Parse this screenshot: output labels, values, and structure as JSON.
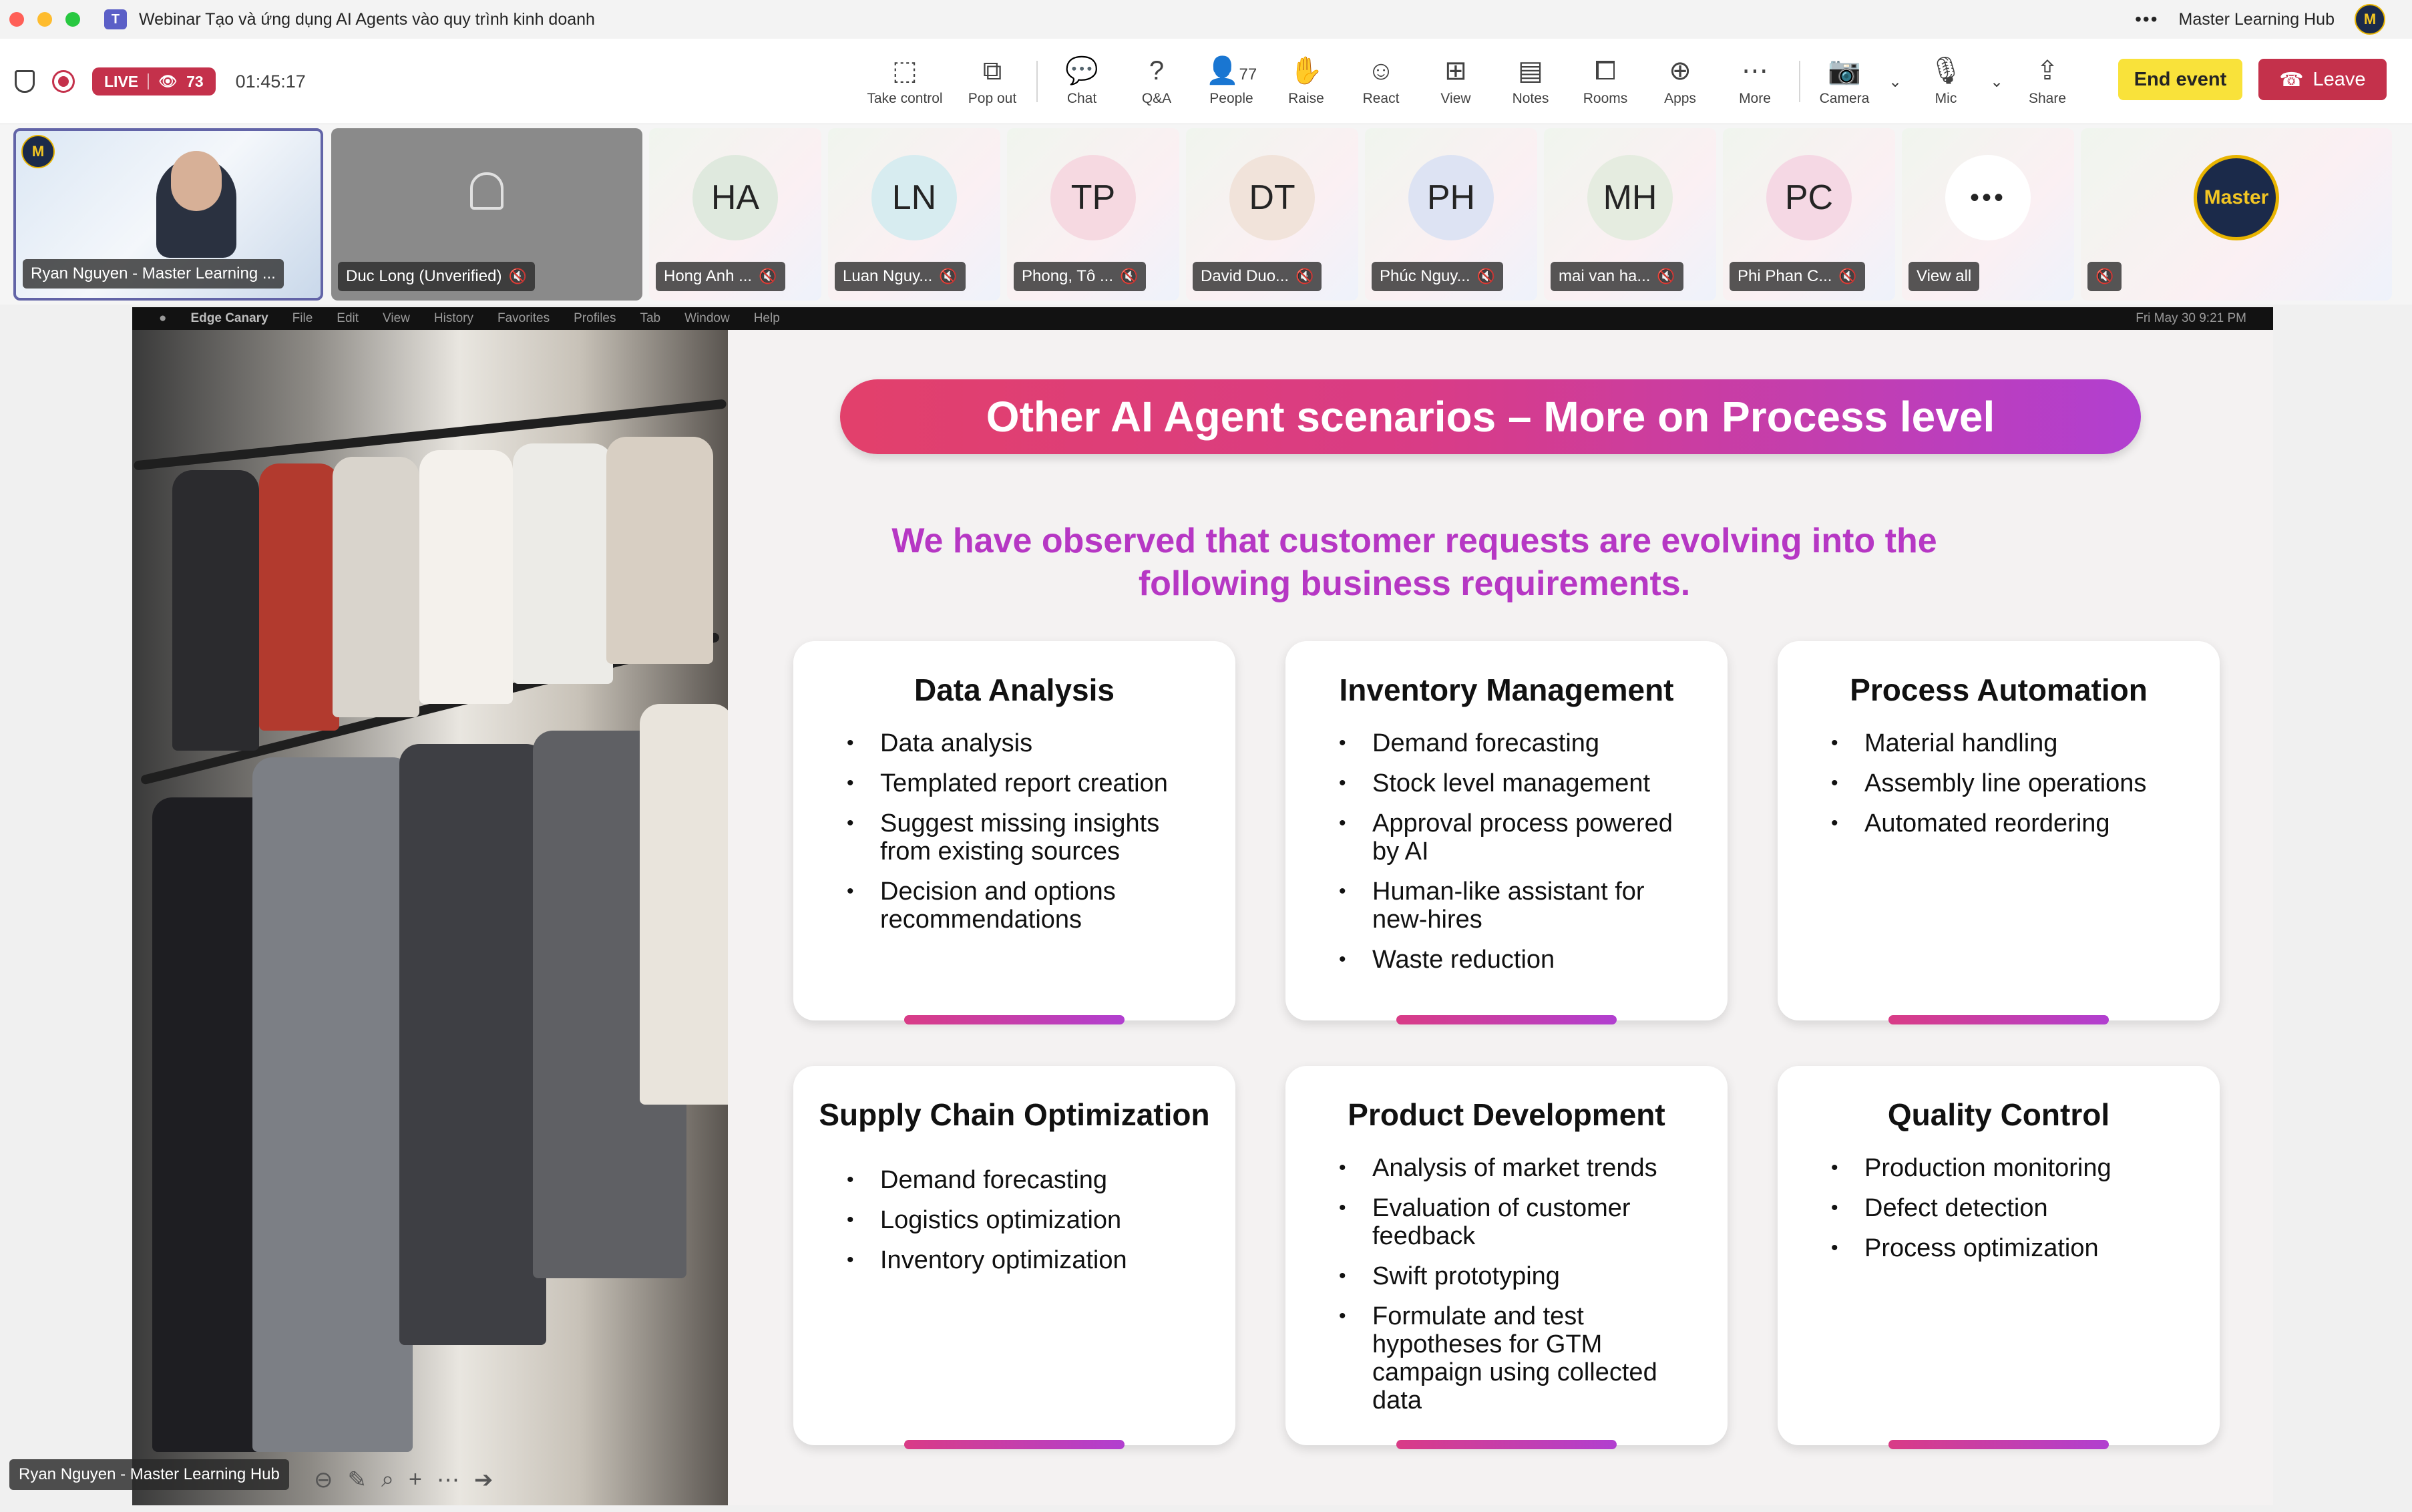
{
  "window": {
    "title": "Webinar Tạo và ứng dụng AI Agents vào quy trình kinh doanh",
    "org": "Master Learning Hub"
  },
  "status": {
    "live": "LIVE",
    "viewers": "73",
    "elapsed": "01:45:17"
  },
  "toolbar": {
    "take_control": "Take control",
    "pop_out": "Pop out",
    "chat": "Chat",
    "qa": "Q&A",
    "people": "People",
    "people_count": "77",
    "raise": "Raise",
    "react": "React",
    "view": "View",
    "notes": "Notes",
    "rooms": "Rooms",
    "apps": "Apps",
    "more": "More",
    "camera": "Camera",
    "mic": "Mic",
    "share": "Share",
    "end_event": "End event",
    "leave": "Leave"
  },
  "participants": [
    {
      "name": "Ryan Nguyen - Master Learning ..."
    },
    {
      "name": "Duc Long (Unverified)"
    },
    {
      "initials": "HA",
      "name": "Hong Anh ...",
      "color": "#dfe9de"
    },
    {
      "initials": "LN",
      "name": "Luan Nguy...",
      "color": "#d7ecf0"
    },
    {
      "initials": "TP",
      "name": "Phong, Tô ...",
      "color": "#f6d9e1"
    },
    {
      "initials": "DT",
      "name": "David Duo...",
      "color": "#f1e3da"
    },
    {
      "initials": "PH",
      "name": "Phúc Nguy...",
      "color": "#dde3f3"
    },
    {
      "initials": "MH",
      "name": "mai van ha...",
      "color": "#e5ece0"
    },
    {
      "initials": "PC",
      "name": "Phi Phan C...",
      "color": "#f5d8e4"
    },
    {
      "name": "View all"
    },
    {
      "logo": "Master"
    }
  ],
  "shared_screen": {
    "menubar": [
      "Edge Canary",
      "File",
      "Edit",
      "View",
      "History",
      "Favorites",
      "Profiles",
      "Tab",
      "Window",
      "Help"
    ],
    "clock": "Fri May 30  9:21 PM"
  },
  "slide": {
    "title": "Other AI Agent scenarios – More on Process level",
    "subtitle": "We have observed that customer requests are evolving into the following business requirements.",
    "cards": [
      {
        "title": "Data Analysis",
        "items": [
          "Data analysis",
          "Templated report creation",
          "Suggest missing insights from existing sources",
          "Decision and options recommendations"
        ]
      },
      {
        "title": "Inventory Management",
        "items": [
          "Demand forecasting",
          "Stock level management",
          "Approval process powered by AI",
          "Human-like assistant for new-hires",
          "Waste reduction"
        ]
      },
      {
        "title": "Process Automation",
        "items": [
          "Material handling",
          "Assembly line operations",
          "Automated reordering"
        ]
      },
      {
        "title": "Supply Chain Optimization",
        "items": [
          "Demand forecasting",
          "Logistics optimization",
          "Inventory optimization"
        ]
      },
      {
        "title": "Product Development",
        "items": [
          "Analysis of market trends",
          "Evaluation of customer feedback",
          "Swift prototyping",
          "Formulate and test hypotheses for GTM campaign using collected data"
        ]
      },
      {
        "title": "Quality Control",
        "items": [
          "Production monitoring",
          "Defect detection",
          "Process optimization"
        ]
      }
    ]
  },
  "presenter": "Ryan Nguyen - Master Learning Hub",
  "colors": {
    "accent": "#6264a7",
    "live": "#c4314b",
    "end": "#f9e23a",
    "slide_gradient_start": "#e2406b",
    "slide_gradient_end": "#b13fd0",
    "subtitle": "#b637c4"
  }
}
